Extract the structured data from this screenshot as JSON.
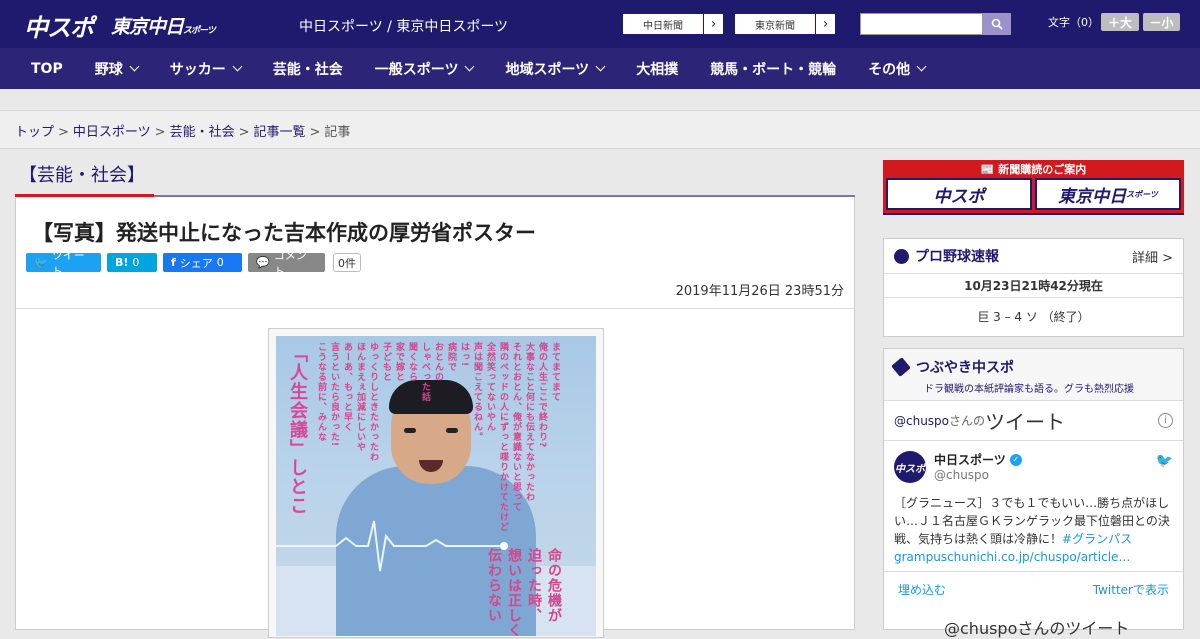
{
  "header": {
    "logo_chunichi": "中スポ",
    "logo_tokyo": "東京中日",
    "logo_tokyo_small": "スポーツ",
    "site_title": "中日スポーツ / 東京中日スポーツ",
    "paper1": "中日新聞",
    "paper2": "東京新聞",
    "search_placeholder": "",
    "fontsize_label": "文字（0）",
    "font_up": "＋大",
    "font_down": "－小"
  },
  "nav": [
    {
      "label": "TOP",
      "dropdown": false
    },
    {
      "label": "野球",
      "dropdown": true
    },
    {
      "label": "サッカー",
      "dropdown": true
    },
    {
      "label": "芸能・社会",
      "dropdown": false
    },
    {
      "label": "一般スポーツ",
      "dropdown": true
    },
    {
      "label": "地域スポーツ",
      "dropdown": true
    },
    {
      "label": "大相撲",
      "dropdown": false
    },
    {
      "label": "競馬・ボート・競輪",
      "dropdown": false
    },
    {
      "label": "その他",
      "dropdown": true
    }
  ],
  "breadcrumb": {
    "items": [
      "トップ",
      "中日スポーツ",
      "芸能・社会",
      "記事一覧"
    ],
    "current": "記事",
    "sep": ">"
  },
  "article": {
    "category": "【芸能・社会】",
    "title": "【写真】発送中止になった吉本作成の厚労省ポスター",
    "date": "2019年11月26日 23時51分",
    "share": {
      "tweet": "ツイート",
      "hatena": "B!",
      "hatena_count": "0",
      "facebook": "シェア",
      "facebook_count": "0",
      "comment": "コメント",
      "comment_count": "0件"
    },
    "poster": {
      "headline": "「人生会議」しとこ",
      "lines": [
        "まてまてまて",
        "俺の人生ここで終わり?",
        "大事なこと何にも伝えてなかったわ",
        "それとおとん、俺が意識ないと思って",
        "隣のベッドの人にずっと喋りかけてたけど",
        "全然笑ってないやん",
        "声は聞こえてるねん。",
        "はっ!",
        "病院で",
        "おとんの",
        "しゃべった話",
        "聞くなら",
        "家で嫁と",
        "子どもと",
        "ゆっくりしときたかったわ",
        "ほんまえぇ加減にしいや",
        "あーあ、もっと早く",
        "言うといたら良かった!",
        "こうなる前に、みんな"
      ],
      "bottom": [
        "命の危機が",
        "迫った時、",
        "想いは正しく",
        "伝わらない"
      ]
    }
  },
  "sidebar": {
    "subscribe": {
      "title": "新聞購読のご案内",
      "btn1": "中スポ",
      "btn2": "東京中日",
      "btn2_small": "スポーツ"
    },
    "baseball": {
      "title": "プロ野球速報",
      "detail": "詳細 >",
      "time": "10月23日21時42分現在",
      "score": "巨 3 – 4 ソ （終了）"
    },
    "tweets": {
      "title": "つぶやき中スポ",
      "subtitle": "ドラ観戦の本紙評論家も語る。グラも熱烈応援",
      "handle_prefix": "@chuspo",
      "handle_suffix": "さんの",
      "heading": "ツイート",
      "user_name": "中日スポーツ",
      "user_handle": "@chuspo",
      "avatar_text": "中スポ",
      "text": "［グラニュース］３でも１でもいい…勝ち点がほしい…Ｊ１名古屋ＧＫランゲラック最下位磐田との決戦、気持ちは熱く頭は冷静に！",
      "hashtag": "#グランパス",
      "link": "grampuschunichi.co.jp/chuspo/article…",
      "embed": "埋め込む",
      "view_on_twitter": "Twitterで表示",
      "next": "@chuspoさんのツイート"
    }
  },
  "colors": {
    "brand": "#1f1a6e",
    "nav": "#2c2477",
    "accent_red": "#d2191e"
  }
}
